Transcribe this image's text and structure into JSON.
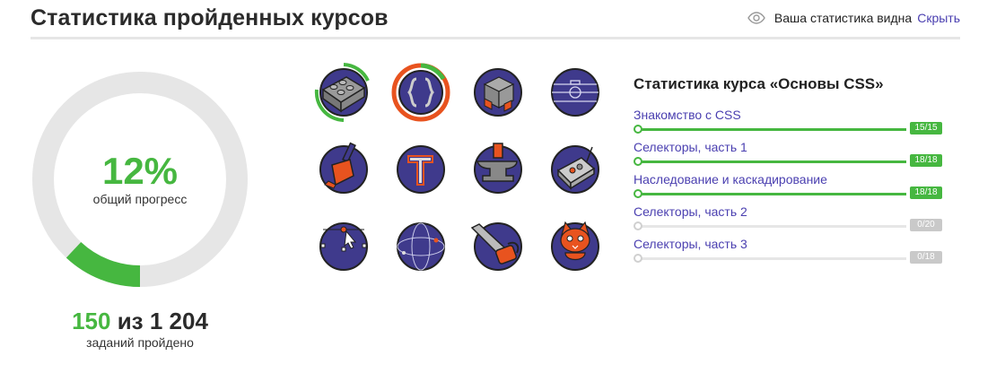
{
  "header": {
    "title": "Статистика пройденных курсов",
    "visibility_text": "Ваша статистика видна",
    "hide_label": "Скрыть"
  },
  "progress": {
    "percent_label": "12%",
    "percent_value": 0.12,
    "caption": "общий прогресс",
    "tasks_done": "150",
    "tasks_separator": "из",
    "tasks_total": "1 204",
    "tasks_caption": "заданий пройдено",
    "color_done": "#46b740",
    "color_track": "#e6e6e6"
  },
  "badges": [
    {
      "name": "lego-brick-badge",
      "progress": 0.3
    },
    {
      "name": "curly-braces-badge",
      "progress": 1.0,
      "selected": true
    },
    {
      "name": "rubiks-cube-badge"
    },
    {
      "name": "football-field-badge"
    },
    {
      "name": "paint-brush-badge"
    },
    {
      "name": "letter-t-badge"
    },
    {
      "name": "anvil-hammer-badge"
    },
    {
      "name": "control-box-badge"
    },
    {
      "name": "vector-path-badge"
    },
    {
      "name": "sphere-badge"
    },
    {
      "name": "chainsaw-badge"
    },
    {
      "name": "cat-mascot-badge"
    }
  ],
  "course": {
    "title": "Статистика курса «Основы CSS»",
    "lessons": [
      {
        "name": "Знакомство с CSS",
        "score": "15/15",
        "progress": 1.0
      },
      {
        "name": "Селекторы, часть 1",
        "score": "18/18",
        "progress": 1.0
      },
      {
        "name": "Наследование и каскадирование",
        "score": "18/18",
        "progress": 1.0
      },
      {
        "name": "Селекторы, часть 2",
        "score": "0/20",
        "progress": 0.0
      },
      {
        "name": "Селекторы, часть 3",
        "score": "0/18",
        "progress": 0.0
      }
    ]
  },
  "colors": {
    "accent": "#4a3fb0",
    "success": "#46b740",
    "badge_fill": "#3f3a8c",
    "badge_orange": "#e8531f"
  }
}
